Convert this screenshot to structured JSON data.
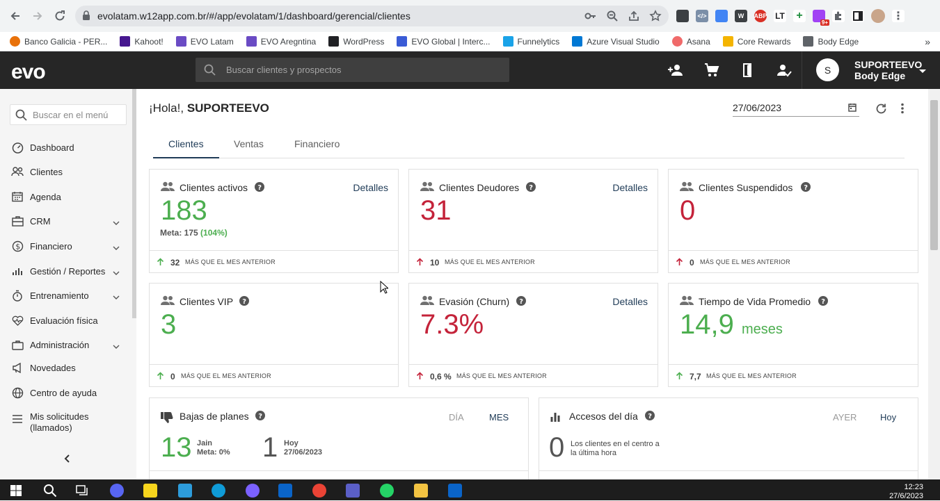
{
  "browser": {
    "url": "evolatam.w12app.com.br/#/app/evolatam/1/dashboard/gerencial/clientes",
    "bookmarks": [
      "Banco Galicia - PER...",
      "Kahoot!",
      "EVO Latam",
      "EVO Aregntina",
      "WordPress",
      "EVO Global | Interc...",
      "Funnelytics",
      "Azure Visual Studio",
      "Asana",
      "Core Rewards",
      "Body Edge"
    ],
    "bookmark_more": "»",
    "ext_badge": "9+"
  },
  "header": {
    "logo": "evo",
    "search_placeholder": "Buscar clientes y prospectos",
    "avatar_initial": "S",
    "user_name": "SUPORTEEVO",
    "gym_name": "Body Edge"
  },
  "sidebar": {
    "search_placeholder": "Buscar en el menú",
    "items": [
      {
        "label": "Dashboard",
        "icon": "dashboard-icon"
      },
      {
        "label": "Clientes",
        "icon": "users-icon"
      },
      {
        "label": "Agenda",
        "icon": "calendar-icon"
      },
      {
        "label": "CRM",
        "icon": "crm-icon"
      },
      {
        "label": "Financiero",
        "icon": "dollar-icon"
      },
      {
        "label": "Gestión / Reportes",
        "icon": "bar-chart-icon"
      },
      {
        "label": "Entrenamiento",
        "icon": "stopwatch-icon"
      },
      {
        "label": "Evaluación física",
        "icon": "heartbeat-icon"
      },
      {
        "label": "Administración",
        "icon": "briefcase-icon"
      },
      {
        "label": "Novedades",
        "icon": "megaphone-icon"
      },
      {
        "label": "Centro de ayuda",
        "icon": "globe-icon"
      },
      {
        "label": "Mis solicitudes",
        "label2": "(llamados)",
        "icon": "list-icon"
      }
    ]
  },
  "page": {
    "greeting_prefix": "¡Hola!,",
    "greeting_name": "SUPORTEEVO",
    "date": "27/06/2023",
    "tabs": [
      "Clientes",
      "Ventas",
      "Financiero"
    ]
  },
  "cards": {
    "activos": {
      "title": "Clientes activos",
      "details": "Detalles",
      "value": "183",
      "meta_label": "Meta: 175",
      "meta_pct": "(104%)",
      "delta": "32",
      "delta_text": "MÁS QUE EL MES ANTERIOR"
    },
    "deudores": {
      "title": "Clientes Deudores",
      "details": "Detalles",
      "value": "31",
      "delta": "10",
      "delta_text": "MÁS QUE EL MES ANTERIOR"
    },
    "suspendidos": {
      "title": "Clientes Suspendidos",
      "value": "0",
      "delta": "0",
      "delta_text": "MÁS QUE EL MES ANTERIOR"
    },
    "vip": {
      "title": "Clientes VIP",
      "value": "3",
      "delta": "0",
      "delta_text": "MÁS QUE EL MES ANTERIOR"
    },
    "churn": {
      "title": "Evasión (Churn)",
      "details": "Detalles",
      "value": "7.3%",
      "delta": "0,6 %",
      "delta_text": "MÁS QUE EL MES ANTERIOR"
    },
    "vida": {
      "title": "Tiempo de Vida Promedio",
      "value": "14,9",
      "unit": "meses",
      "delta": "7,7",
      "delta_text": "MÁS QUE EL MES ANTERIOR"
    },
    "bajas": {
      "title": "Bajas de planes",
      "seg_day": "DÍA",
      "seg_month": "MES",
      "value": "13",
      "label1": "Jain",
      "label2": "Meta: 0%",
      "value2": "1",
      "label3": "Hoy",
      "label4": "27/06/2023"
    },
    "accesos": {
      "title": "Accesos del día",
      "seg_yesterday": "AYER",
      "seg_today": "Hoy",
      "value": "0",
      "label1": "Los clientes en el centro a",
      "label2": "la última hora"
    }
  },
  "taskbar": {
    "time": "12:23",
    "date": "27/6/2023"
  },
  "colors": {
    "green": "#4cae4f",
    "red": "#c4233a",
    "navy": "#1f3b57",
    "topbar": "#262626"
  }
}
